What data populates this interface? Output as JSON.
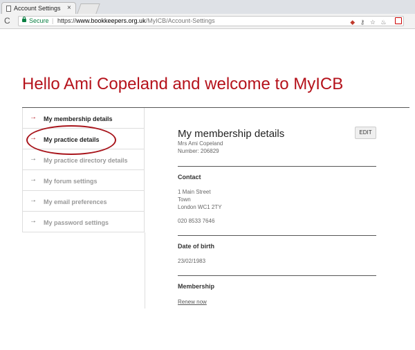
{
  "browser": {
    "tab_title": "Account Settings",
    "tab_close": "×",
    "back": "C",
    "secure_label": "Secure",
    "url_scheme": "https://",
    "url_host": "www.bookkeepers.org.uk",
    "url_path": "/MyICB/Account-Settings",
    "icons": [
      "shield-icon",
      "key-icon",
      "star-icon",
      "extension-icon",
      "pocket-icon"
    ]
  },
  "page": {
    "greeting": "Hello Ami Copeland and welcome to MyICB",
    "accent_color": "#b5121b"
  },
  "sidebar": {
    "items": [
      {
        "label": "My membership details",
        "active": true
      },
      {
        "label": "My practice details",
        "active": true
      },
      {
        "label": "My practice directory details",
        "active": false
      },
      {
        "label": "My forum settings",
        "active": false
      },
      {
        "label": "My email preferences",
        "active": false
      },
      {
        "label": "My password settings",
        "active": false
      }
    ]
  },
  "main": {
    "title": "My membership details",
    "edit_label": "EDIT",
    "name": "Mrs Ami Copeland",
    "number": "Number: 206829",
    "contact": {
      "heading": "Contact",
      "address_line1": "1 Main Street",
      "address_line2": "Town",
      "address_line3": "London WC1 2TY",
      "phone": "020 8533 7646"
    },
    "dob": {
      "heading": "Date of birth",
      "value": "23/02/1983"
    },
    "membership": {
      "heading": "Membership",
      "renew_label": "Renew now"
    }
  }
}
